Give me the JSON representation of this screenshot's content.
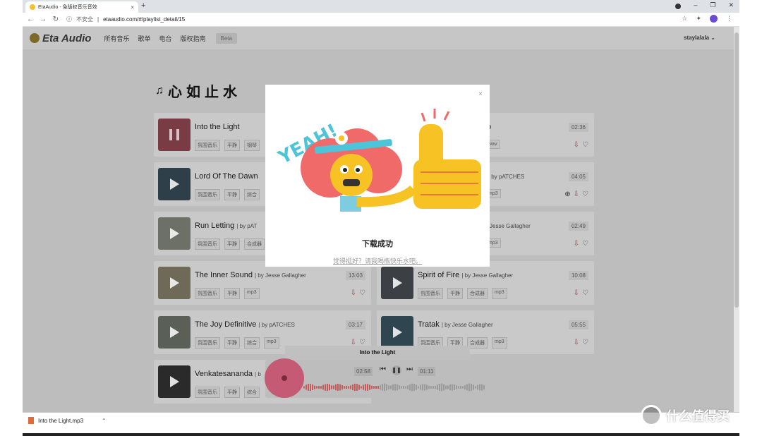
{
  "browser": {
    "tab_title": "EtaAudio - 免版权音乐音效",
    "tab_close": "×",
    "new_tab": "+",
    "insecure_label": "不安全",
    "url": "etaaudio.com/#/playlist_detail/15"
  },
  "site": {
    "logo_text": "Eta Audio",
    "nav": [
      "所有音乐",
      "歌单",
      "电台",
      "版权指南"
    ],
    "beta": "Beta",
    "username": "staylalala",
    "playlist_title": "心如止水"
  },
  "tracks_left": [
    {
      "title": "Into the Light",
      "by": "",
      "tags": [
        "氛围音乐",
        "平静",
        "钢琴"
      ],
      "duration": ""
    },
    {
      "title": "Lord Of The Dawn",
      "by": "",
      "tags": [
        "氛围音乐",
        "平静",
        "综合"
      ],
      "duration": ""
    },
    {
      "title": "Run Letting",
      "by": "| by pAT",
      "tags": [
        "氛围音乐",
        "平静",
        "合成器"
      ],
      "duration": ""
    },
    {
      "title": "The Inner Sound",
      "by": "| by Jesse Gallagher",
      "tags": [
        "氛围音乐",
        "平静",
        "mp3"
      ],
      "duration": "13:03"
    },
    {
      "title": "The Joy Definitive",
      "by": "| by pATCHES",
      "tags": [
        "氛围音乐",
        "平静",
        "综合",
        "mp3"
      ],
      "duration": "03:17"
    },
    {
      "title": "Venkatesananda",
      "by": "| b",
      "tags": [
        "氛围音乐",
        "平静",
        "综合"
      ],
      "duration": ""
    }
  ],
  "tracks_right": [
    {
      "title": "o",
      "by": "",
      "tags": [
        "wav"
      ],
      "duration": "02:36"
    },
    {
      "title": "",
      "by": "| by pATCHES",
      "tags": [
        "mp3"
      ],
      "duration": "04:05"
    },
    {
      "title": "",
      "by": "Jesse Gallagher",
      "tags": [
        "mp3"
      ],
      "duration": "02:49"
    },
    {
      "title": "Spirit of Fire",
      "by": "| by Jesse Gallagher",
      "tags": [
        "氛围音乐",
        "平静",
        "合成器",
        "mp3"
      ],
      "duration": "10:08"
    },
    {
      "title": "Tratak",
      "by": "| by Jesse Gallagher",
      "tags": [
        "氛围音乐",
        "平静",
        "合成器",
        "mp3"
      ],
      "duration": "05:55"
    }
  ],
  "modal": {
    "close": "×",
    "title": "下载成功",
    "tip": "觉得挺好？请我喝瓶快乐水吧。",
    "art_text": "YEAH!"
  },
  "player": {
    "now_playing": "Into the Light",
    "elapsed": "02:58",
    "remaining": "01:11"
  },
  "downloads": {
    "file": "Into the Light.mp3"
  },
  "watermark": {
    "text": "什么值得买"
  }
}
